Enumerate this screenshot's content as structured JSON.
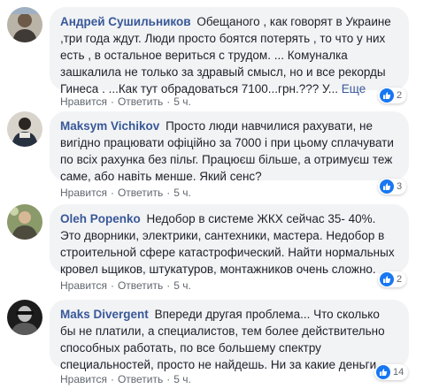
{
  "comments": [
    {
      "author": "Андрей Сушильников",
      "text": "Обещаного , как говорят в Украине ,три года ждут. Люди просто боятся потерять , то что у них есть , в остальное вериться с трудом. ... Комуналка зашкалила не только за здравый смысл, но и все рекорды Гинеса . ...Как тут обрадоваться 7100...грн.??? У...",
      "more": "Еще",
      "like": "Нравится",
      "reply": "Ответить",
      "time": "5 ч.",
      "reactions": "2",
      "avatar_icon": "profile-photo"
    },
    {
      "author": "Maksym Vichikov",
      "text": "Просто люди навчилися рахувати, не вигідно працювати офіційно за 7000 і при цьому сплачувати по всіх рахунка без пільг. Працюєш більше, а отримуєш теж саме, або навіть менше. Який сенс?",
      "like": "Нравится",
      "reply": "Ответить",
      "time": "5 ч.",
      "reactions": "3",
      "avatar_icon": "profile-photo"
    },
    {
      "author": "Oleh Popenko",
      "text": "Недобор в системе ЖКХ сейчас 35- 40%. Это дворники, электрики, сантехники, мастера. Недобор в строительной сфере катастрофический. Найти нормальных кровел ьщиков, штукатуров, монтажников очень сложно.",
      "like": "Нравится",
      "reply": "Ответить",
      "time": "5 ч.",
      "reactions": "2",
      "avatar_icon": "profile-photo"
    },
    {
      "author": "Maks Divergent",
      "text": "Впереди другая проблема... Что сколько бы не платили, а специалистов, тем более действительно способных работать, по все большему спектру специальностей, просто не найдешь. Ни за какие деньги.",
      "like": "Нравится",
      "reply": "Ответить",
      "time": "5 ч.",
      "reactions": "14",
      "avatar_icon": "profile-photo"
    }
  ],
  "colors": {
    "author": "#385898",
    "bubble": "#f2f3f5",
    "like_badge": "#1877f2"
  }
}
